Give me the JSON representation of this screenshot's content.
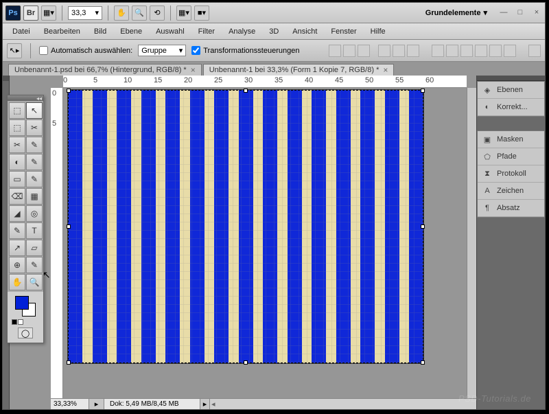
{
  "topbar": {
    "zoom": "33,3",
    "workspace": "Grundelemente"
  },
  "menu": [
    "Datei",
    "Bearbeiten",
    "Bild",
    "Ebene",
    "Auswahl",
    "Filter",
    "Analyse",
    "3D",
    "Ansicht",
    "Fenster",
    "Hilfe"
  ],
  "optbar": {
    "autoselect": "Automatisch auswählen:",
    "group": "Gruppe",
    "transform": "Transformationssteuerungen"
  },
  "tabs": [
    {
      "label": "Unbenannt-1.psd bei 66,7% (Hintergrund, RGB/8) *",
      "active": false
    },
    {
      "label": "Unbenannt-1 bei 33,3% (Form 1 Kopie 7, RGB/8) *",
      "active": true
    }
  ],
  "ruler_marks": [
    "0",
    "5",
    "10",
    "15",
    "20",
    "25",
    "30",
    "35",
    "40",
    "45",
    "50",
    "55",
    "60"
  ],
  "ruler_v": [
    "0",
    "5"
  ],
  "panels": {
    "g1": [
      {
        "icon": "layers",
        "label": "Ebenen"
      },
      {
        "icon": "adjust",
        "label": "Korrekt..."
      }
    ],
    "g2": [
      {
        "icon": "mask",
        "label": "Masken"
      },
      {
        "icon": "paths",
        "label": "Pfade"
      },
      {
        "icon": "history",
        "label": "Protokoll"
      },
      {
        "icon": "char",
        "label": "Zeichen"
      },
      {
        "icon": "para",
        "label": "Absatz"
      }
    ]
  },
  "status": {
    "zoom": "33,33%",
    "dok": "Dok: 5,49 MB/8,45 MB"
  },
  "watermark": "PSD-Tutorials.de",
  "tools": [
    [
      "⬚",
      "↖"
    ],
    [
      "⬚",
      "✂"
    ],
    [
      "✂",
      "✎"
    ],
    [
      "◐",
      "✎"
    ],
    [
      "▭",
      "✎"
    ],
    [
      "⌫",
      "▦"
    ],
    [
      "◢",
      "◎"
    ],
    [
      "✎",
      "T"
    ],
    [
      "↗",
      "▱"
    ],
    [
      "⊕",
      "✎"
    ],
    [
      "✋",
      "🔍"
    ]
  ]
}
